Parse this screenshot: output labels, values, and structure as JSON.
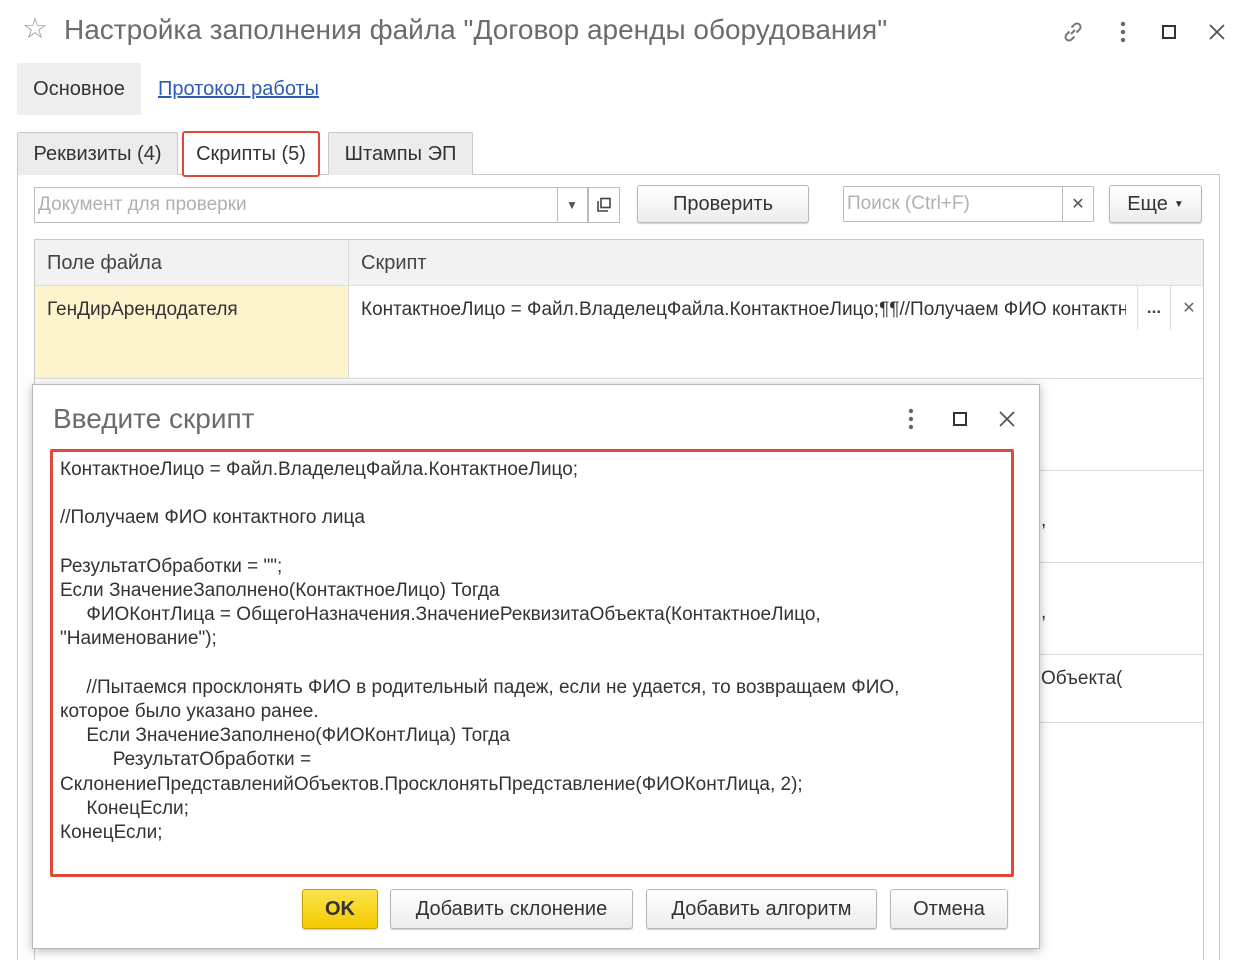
{
  "window": {
    "title": "Настройка заполнения файла \"Договор аренды оборудования\""
  },
  "sections": {
    "main": "Основное",
    "log": "Протокол работы"
  },
  "tabs": [
    {
      "label": "Реквизиты (4)"
    },
    {
      "label": "Скрипты (5)"
    },
    {
      "label": "Штампы ЭП"
    }
  ],
  "toolbar": {
    "document_placeholder": "Документ для проверки",
    "check_label": "Проверить",
    "search_placeholder": "Поиск (Ctrl+F)",
    "more_label": "Еще"
  },
  "table": {
    "columns": [
      "Поле файла",
      "Скрипт"
    ],
    "rows": [
      {
        "field": "ГенДирАрендодателя",
        "script": "КонтактноеЛицо = Файл.ВладелецФайла.КонтактноеЛицо;¶¶//Получаем ФИО контактного лица"
      }
    ],
    "peek": [
      ",",
      ",",
      "Объекта("
    ]
  },
  "dialog": {
    "title": "Введите скрипт",
    "script": "КонтактноеЛицо = Файл.ВладелецФайла.КонтактноеЛицо;\n\n//Получаем ФИО контактного лица\n\nРезультатОбработки = \"\";\nЕсли ЗначениеЗаполнено(КонтактноеЛицо) Тогда\n\tФИОКонтЛица = ОбщегоНазначения.ЗначениеРеквизитаОбъекта(КонтактноеЛицо,\n\"Наименование\");\n\n\t//Пытаемся просклонять ФИО в родительный падеж, если не удается, то возвращаем ФИО,\nкоторое было указано ранее.\n\tЕсли ЗначениеЗаполнено(ФИОКонтЛица) Тогда\n\t\tРезультатОбработки =\nСклонениеПредставленийОбъектов.ПросклонятьПредставление(ФИОКонтЛица, 2);\n\tКонецЕсли;\nКонецЕсли;",
    "ok_label": "OK",
    "add_declension_label": "Добавить склонение",
    "add_algorithm_label": "Добавить алгоритм",
    "cancel_label": "Отмена"
  },
  "colors": {
    "highlight": "#e0483a",
    "ok_button": "#f3c800",
    "selected_cell": "#fdf4cd",
    "link": "#2f5bb7"
  }
}
